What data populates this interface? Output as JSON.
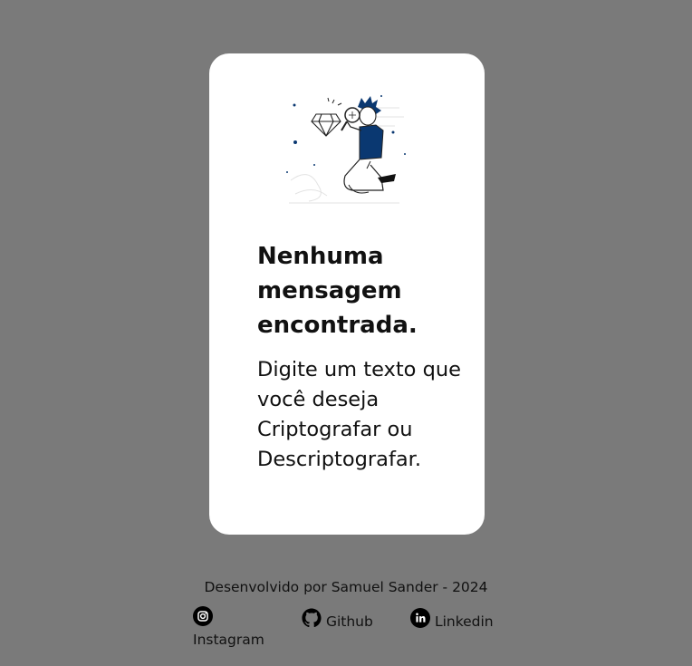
{
  "output_panel": {
    "title": "Nenhuma mensagem encontrada.",
    "description": "Digite um texto que você deseja Criptografar ou Descriptografar."
  },
  "footer": {
    "credit": "Desenvolvido por Samuel Sander - 2024",
    "links": {
      "instagram": "Instagram",
      "github": "Github",
      "linkedin": "Linkedin"
    }
  },
  "colors": {
    "background": "#7a7a7a",
    "card": "#ffffff",
    "accent": "#0a3871",
    "text": "#111111"
  },
  "icons": [
    "instagram-icon",
    "github-icon",
    "linkedin-icon"
  ]
}
